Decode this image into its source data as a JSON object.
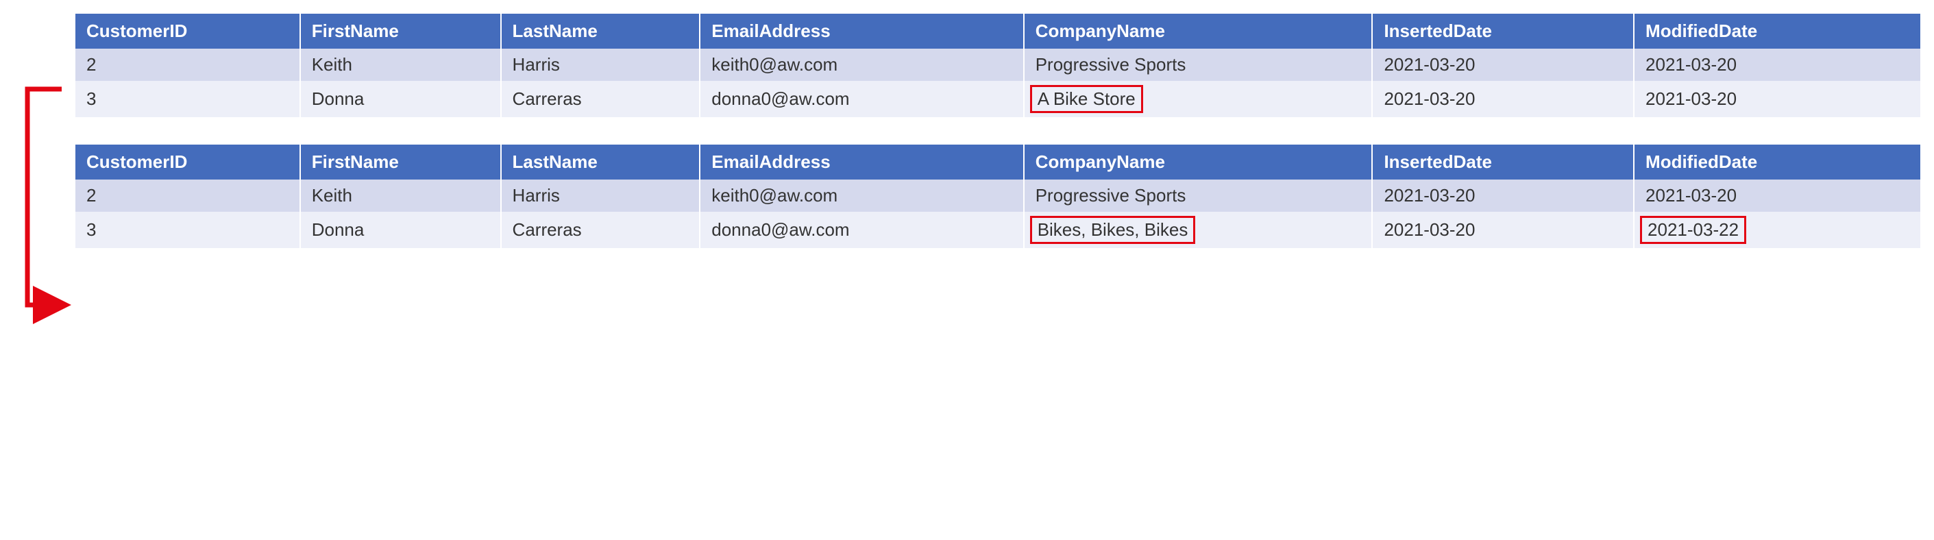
{
  "columns": {
    "customer_id": "CustomerID",
    "first_name": "FirstName",
    "last_name": "LastName",
    "email": "EmailAddress",
    "company": "CompanyName",
    "inserted": "InsertedDate",
    "modified": "ModifiedDate"
  },
  "table_before": [
    {
      "id": "2",
      "first": "Keith",
      "last": "Harris",
      "email": "keith0@aw.com",
      "company": "Progressive Sports",
      "inserted": "2021-03-20",
      "modified": "2021-03-20",
      "hl_company": false,
      "hl_modified": false
    },
    {
      "id": "3",
      "first": "Donna",
      "last": "Carreras",
      "email": "donna0@aw.com",
      "company": "A Bike Store",
      "inserted": "2021-03-20",
      "modified": "2021-03-20",
      "hl_company": true,
      "hl_modified": false
    }
  ],
  "table_after": [
    {
      "id": "2",
      "first": "Keith",
      "last": "Harris",
      "email": "keith0@aw.com",
      "company": "Progressive Sports",
      "inserted": "2021-03-20",
      "modified": "2021-03-20",
      "hl_company": false,
      "hl_modified": false
    },
    {
      "id": "3",
      "first": "Donna",
      "last": "Carreras",
      "email": "donna0@aw.com",
      "company": "Bikes, Bikes, Bikes",
      "inserted": "2021-03-20",
      "modified": "2021-03-22",
      "hl_company": true,
      "hl_modified": true
    }
  ],
  "arrow_color": "#e30613"
}
